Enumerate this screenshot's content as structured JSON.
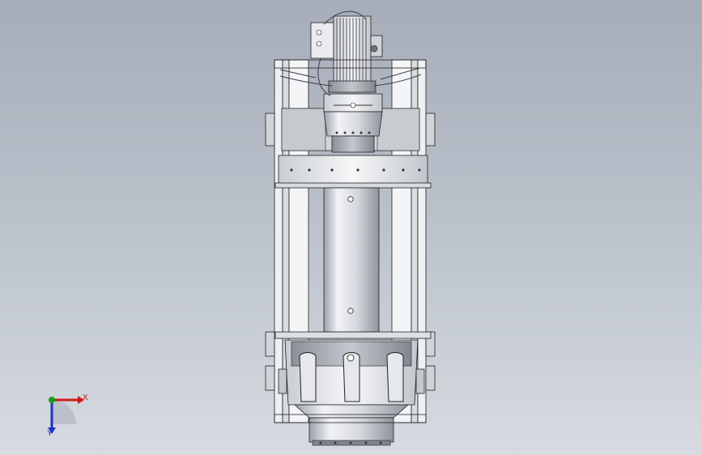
{
  "viewport": {
    "background_top": "#a6adb8",
    "background_bottom": "#d7dbe1"
  },
  "triad": {
    "x_label": "X",
    "y_label": "Y",
    "x_color": "#d01818",
    "y_color": "#1a33c8",
    "z_color": "#18a018"
  }
}
